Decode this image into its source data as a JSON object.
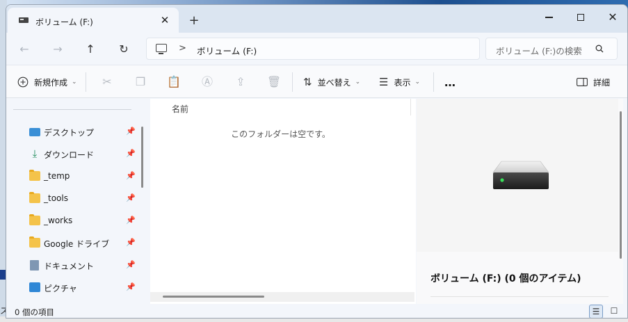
{
  "window": {
    "tab_title": "ボリューム (F:)",
    "tab_close": "✕",
    "new_tab": "+",
    "minimize": "",
    "maximize": "",
    "close": "✕"
  },
  "nav": {
    "back": "←",
    "forward": "→",
    "up": "↑",
    "refresh": "↻",
    "breadcrumb_sep": ">",
    "breadcrumb": "ボリューム (F:)",
    "search_placeholder": "ボリューム (F:)の検索"
  },
  "toolbar": {
    "new_label": "新規作成",
    "sort_label": "並べ替え",
    "view_label": "表示",
    "more": "…",
    "details_label": "詳細"
  },
  "sidebar": {
    "items": [
      {
        "label": "デスクトップ",
        "icon": "desktop-icon"
      },
      {
        "label": "ダウンロード",
        "icon": "download-icon"
      },
      {
        "label": "_temp",
        "icon": "folder-icon"
      },
      {
        "label": "_tools",
        "icon": "folder-icon"
      },
      {
        "label": "_works",
        "icon": "folder-icon"
      },
      {
        "label": "Google ドライブ",
        "icon": "folder-icon"
      },
      {
        "label": "ドキュメント",
        "icon": "document-icon"
      },
      {
        "label": "ピクチャ",
        "icon": "picture-icon"
      }
    ]
  },
  "main": {
    "column_name": "名前",
    "empty_message": "このフォルダーは空です。"
  },
  "details": {
    "title": "ボリューム (F:) (0 個のアイテム)"
  },
  "status": {
    "item_count": "0 個の項目"
  },
  "background": {
    "left_text": "ス"
  }
}
